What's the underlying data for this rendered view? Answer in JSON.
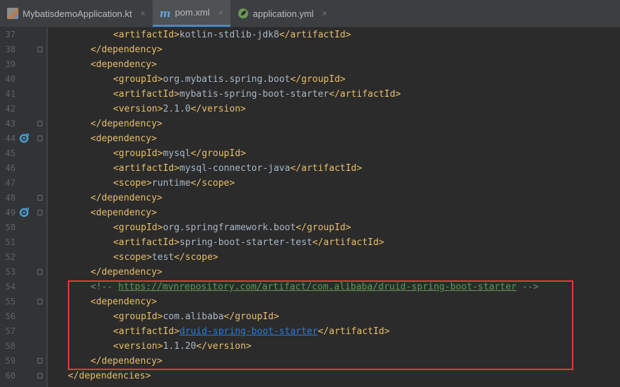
{
  "tabs": [
    {
      "label": "MybatisdemoApplication.kt",
      "icon": "kotlin-file-icon",
      "active": false
    },
    {
      "label": "pom.xml",
      "icon": "maven-file-icon",
      "active": true
    },
    {
      "label": "application.yml",
      "icon": "spring-leaf-icon",
      "active": false
    }
  ],
  "close_glyph": "×",
  "lines": [
    {
      "n": "37",
      "indent": 2,
      "parts": [
        [
          "tag",
          "<artifactId>"
        ],
        [
          "txt",
          "kotlin-stdlib-jdk8"
        ],
        [
          "tag",
          "</artifactId>"
        ]
      ]
    },
    {
      "n": "38",
      "indent": 1,
      "fold": true,
      "parts": [
        [
          "tag",
          "</dependency>"
        ]
      ]
    },
    {
      "n": "39",
      "indent": 1,
      "parts": [
        [
          "tag",
          "<dependency>"
        ]
      ]
    },
    {
      "n": "40",
      "indent": 2,
      "parts": [
        [
          "tag",
          "<groupId>"
        ],
        [
          "txt",
          "org.mybatis.spring.boot"
        ],
        [
          "tag",
          "</groupId>"
        ]
      ]
    },
    {
      "n": "41",
      "indent": 2,
      "parts": [
        [
          "tag",
          "<artifactId>"
        ],
        [
          "txt",
          "mybatis-spring-boot-starter"
        ],
        [
          "tag",
          "</artifactId>"
        ]
      ]
    },
    {
      "n": "42",
      "indent": 2,
      "parts": [
        [
          "tag",
          "<version>"
        ],
        [
          "txt",
          "2.1.0"
        ],
        [
          "tag",
          "</version>"
        ]
      ]
    },
    {
      "n": "43",
      "indent": 1,
      "fold": true,
      "parts": [
        [
          "tag",
          "</dependency>"
        ]
      ]
    },
    {
      "n": "44",
      "indent": 1,
      "fold": true,
      "mark": true,
      "parts": [
        [
          "tag",
          "<dependency>"
        ]
      ]
    },
    {
      "n": "45",
      "indent": 2,
      "parts": [
        [
          "tag",
          "<groupId>"
        ],
        [
          "txt",
          "mysql"
        ],
        [
          "tag",
          "</groupId>"
        ]
      ]
    },
    {
      "n": "46",
      "indent": 2,
      "parts": [
        [
          "tag",
          "<artifactId>"
        ],
        [
          "txt",
          "mysql-connector-java"
        ],
        [
          "tag",
          "</artifactId>"
        ]
      ]
    },
    {
      "n": "47",
      "indent": 2,
      "parts": [
        [
          "tag",
          "<scope>"
        ],
        [
          "txt",
          "runtime"
        ],
        [
          "tag",
          "</scope>"
        ]
      ]
    },
    {
      "n": "48",
      "indent": 1,
      "fold": true,
      "parts": [
        [
          "tag",
          "</dependency>"
        ]
      ]
    },
    {
      "n": "49",
      "indent": 1,
      "fold": true,
      "mark": true,
      "parts": [
        [
          "tag",
          "<dependency>"
        ]
      ]
    },
    {
      "n": "50",
      "indent": 2,
      "parts": [
        [
          "tag",
          "<groupId>"
        ],
        [
          "txt",
          "org.springframework.boot"
        ],
        [
          "tag",
          "</groupId>"
        ]
      ]
    },
    {
      "n": "51",
      "indent": 2,
      "parts": [
        [
          "tag",
          "<artifactId>"
        ],
        [
          "txt",
          "spring-boot-starter-test"
        ],
        [
          "tag",
          "</artifactId>"
        ]
      ]
    },
    {
      "n": "52",
      "indent": 2,
      "parts": [
        [
          "tag",
          "<scope>"
        ],
        [
          "txt",
          "test"
        ],
        [
          "tag",
          "</scope>"
        ]
      ]
    },
    {
      "n": "53",
      "indent": 1,
      "fold": true,
      "parts": [
        [
          "tag",
          "</dependency>"
        ]
      ]
    },
    {
      "n": "54",
      "indent": 1,
      "parts": [
        [
          "cmt",
          "<!-- "
        ],
        [
          "cmtlink",
          "https://mvnrepository.com/artifact/com.alibaba/druid-spring-boot-starter"
        ],
        [
          "cmt",
          " -->"
        ]
      ]
    },
    {
      "n": "55",
      "indent": 1,
      "fold": true,
      "parts": [
        [
          "tag",
          "<dependency>"
        ]
      ]
    },
    {
      "n": "56",
      "indent": 2,
      "parts": [
        [
          "tag",
          "<groupId>"
        ],
        [
          "txt",
          "com.alibaba"
        ],
        [
          "tag",
          "</groupId>"
        ]
      ]
    },
    {
      "n": "57",
      "indent": 2,
      "parts": [
        [
          "tag",
          "<artifactId>"
        ],
        [
          "link",
          "druid-spring-boot-starter"
        ],
        [
          "tag",
          "</artifactId>"
        ]
      ]
    },
    {
      "n": "58",
      "indent": 2,
      "parts": [
        [
          "tag",
          "<version>"
        ],
        [
          "txt",
          "1.1.20"
        ],
        [
          "tag",
          "</version>"
        ]
      ]
    },
    {
      "n": "59",
      "indent": 1,
      "fold": true,
      "parts": [
        [
          "tag",
          "</dependency>"
        ]
      ]
    },
    {
      "n": "60",
      "indent": 0,
      "fold": true,
      "parts": [
        [
          "tag",
          "</dependencies>"
        ]
      ]
    }
  ]
}
